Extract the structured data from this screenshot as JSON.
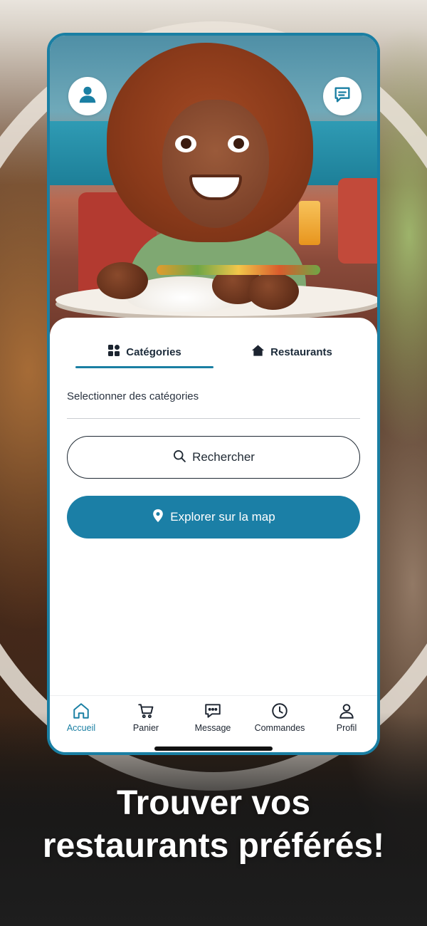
{
  "colors": {
    "accent": "#1a7fa3",
    "map_button": "#1b7fa6",
    "text_dark": "#1c2b3a"
  },
  "header": {
    "profile_icon": "user-icon",
    "chat_icon": "chat-icon"
  },
  "tabs": [
    {
      "label": "Catégories",
      "icon": "grid-icon",
      "active": true
    },
    {
      "label": "Restaurants",
      "icon": "house-icon",
      "active": false
    }
  ],
  "categories_field": {
    "placeholder": "Selectionner des catégories"
  },
  "search_button": {
    "label": "Rechercher",
    "icon": "search-icon"
  },
  "map_button": {
    "label": "Explorer sur la map",
    "icon": "map-pin-icon"
  },
  "nav": [
    {
      "label": "Accueil",
      "icon": "home-icon",
      "active": true
    },
    {
      "label": "Panier",
      "icon": "cart-icon",
      "active": false
    },
    {
      "label": "Message",
      "icon": "message-icon",
      "active": false
    },
    {
      "label": "Commandes",
      "icon": "clock-icon",
      "active": false
    },
    {
      "label": "Profil",
      "icon": "profile-icon",
      "active": false
    }
  ],
  "tagline": {
    "line1": "Trouver vos",
    "line2": "restaurants préférés!"
  }
}
